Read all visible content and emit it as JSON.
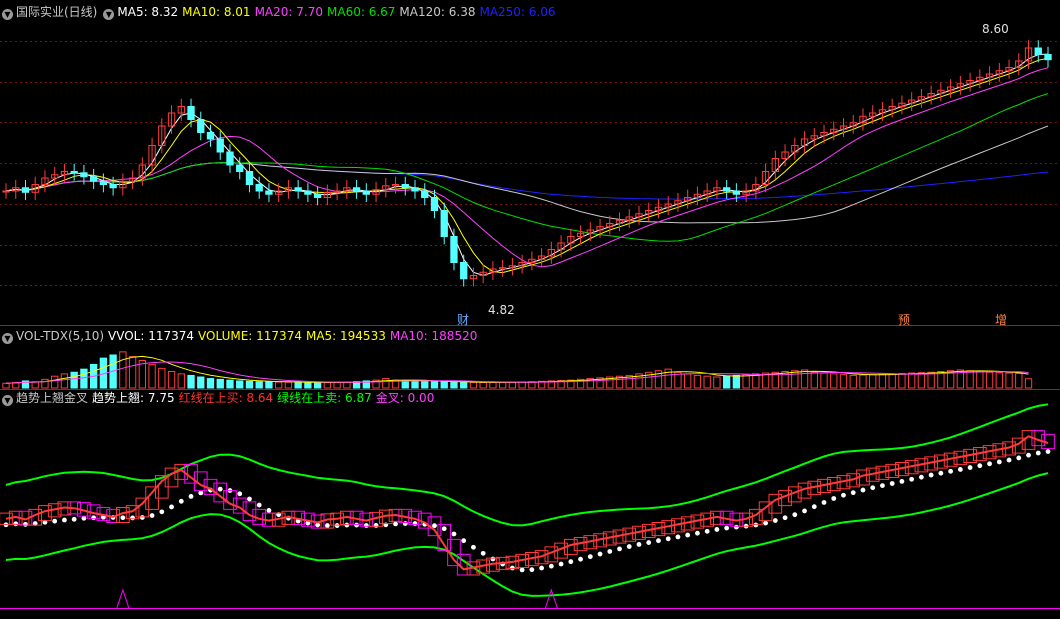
{
  "colors": {
    "up": "#ff3b3b",
    "down": "#54ffff",
    "ma5": "#ffffff",
    "ma10": "#ffff00",
    "ma20": "#ff40ff",
    "ma60": "#00e000",
    "ma120": "#c8c8c8",
    "ma250": "#2020ff",
    "grid": "#7a1010",
    "divider": "#c01010",
    "green_line": "#00ff00",
    "white_dots": "#ffffff",
    "magenta": "#ff00ff"
  },
  "main_legend": {
    "toggle_icon": "chevron-down-icon",
    "title": "国际实业(日线)",
    "ma5": "MA5: 8.32",
    "ma10": "MA10: 8.01",
    "ma20": "MA20: 7.70",
    "ma60": "MA60: 6.67",
    "ma120": "MA120: 6.38",
    "ma250": "MA250: 6.06"
  },
  "annotations": {
    "high_label": "8.60",
    "low_label": "4.82",
    "markers": [
      "财",
      "预",
      "增"
    ]
  },
  "vol_legend": {
    "toggle_icon": "chevron-down-icon",
    "title": "VOL-TDX(5,10)",
    "vvol": "VVOL: 117374",
    "volume": "VOLUME: 117374",
    "ma5": "MA5: 194533",
    "ma10": "MA10: 188520"
  },
  "ind_legend": {
    "toggle_icon": "chevron-down-icon",
    "title": "趋势上翘金叉",
    "trend": "趋势上翘: 7.75",
    "red_line": "红线在上买: 8.64",
    "green_line": "绿线在上卖: 6.87",
    "golden": "金叉: 0.00"
  },
  "chart_data": {
    "type": "candlestick",
    "price_range": [
      4.5,
      8.9
    ],
    "closes": [
      6.3,
      6.35,
      6.28,
      6.4,
      6.5,
      6.55,
      6.6,
      6.58,
      6.52,
      6.45,
      6.4,
      6.35,
      6.45,
      6.5,
      6.7,
      7.0,
      7.3,
      7.5,
      7.6,
      7.4,
      7.2,
      7.1,
      6.9,
      6.7,
      6.6,
      6.4,
      6.3,
      6.25,
      6.3,
      6.35,
      6.3,
      6.25,
      6.2,
      6.28,
      6.3,
      6.35,
      6.3,
      6.25,
      6.32,
      6.38,
      6.4,
      6.35,
      6.3,
      6.2,
      6.0,
      5.6,
      5.2,
      4.95,
      5.0,
      5.05,
      5.1,
      5.12,
      5.15,
      5.2,
      5.25,
      5.3,
      5.4,
      5.5,
      5.6,
      5.65,
      5.7,
      5.75,
      5.8,
      5.85,
      5.9,
      5.95,
      6.0,
      6.05,
      6.1,
      6.15,
      6.2,
      6.25,
      6.3,
      6.35,
      6.3,
      6.25,
      6.3,
      6.4,
      6.6,
      6.8,
      6.9,
      7.0,
      7.1,
      7.15,
      7.2,
      7.25,
      7.3,
      7.35,
      7.45,
      7.5,
      7.55,
      7.6,
      7.65,
      7.7,
      7.75,
      7.8,
      7.85,
      7.9,
      7.95,
      8.0,
      8.05,
      8.1,
      8.15,
      8.2,
      8.3,
      8.5,
      8.4,
      8.32
    ],
    "volume_range": [
      0,
      560000
    ],
    "volumes": [
      60000,
      70000,
      90000,
      80000,
      110000,
      150000,
      180000,
      200000,
      240000,
      300000,
      380000,
      420000,
      460000,
      400000,
      350000,
      300000,
      250000,
      210000,
      180000,
      160000,
      140000,
      120000,
      110000,
      100000,
      90000,
      85000,
      80000,
      78000,
      76000,
      74000,
      72000,
      70000,
      70000,
      70000,
      72000,
      75000,
      80000,
      90000,
      100000,
      120000,
      100000,
      95000,
      90000,
      85000,
      80000,
      78000,
      76000,
      74000,
      72000,
      70000,
      70000,
      72000,
      74000,
      76000,
      80000,
      85000,
      90000,
      95000,
      100000,
      110000,
      120000,
      130000,
      140000,
      150000,
      160000,
      180000,
      200000,
      220000,
      240000,
      200000,
      180000,
      160000,
      150000,
      140000,
      150000,
      160000,
      170000,
      180000,
      190000,
      200000,
      210000,
      220000,
      230000,
      200000,
      190000,
      180000,
      170000,
      160000,
      165000,
      170000,
      175000,
      180000,
      185000,
      190000,
      195000,
      200000,
      210000,
      220000,
      230000,
      220000,
      210000,
      200000,
      195000,
      190000,
      185000,
      117374
    ],
    "indicator_range": [
      4.0,
      9.2
    ]
  }
}
